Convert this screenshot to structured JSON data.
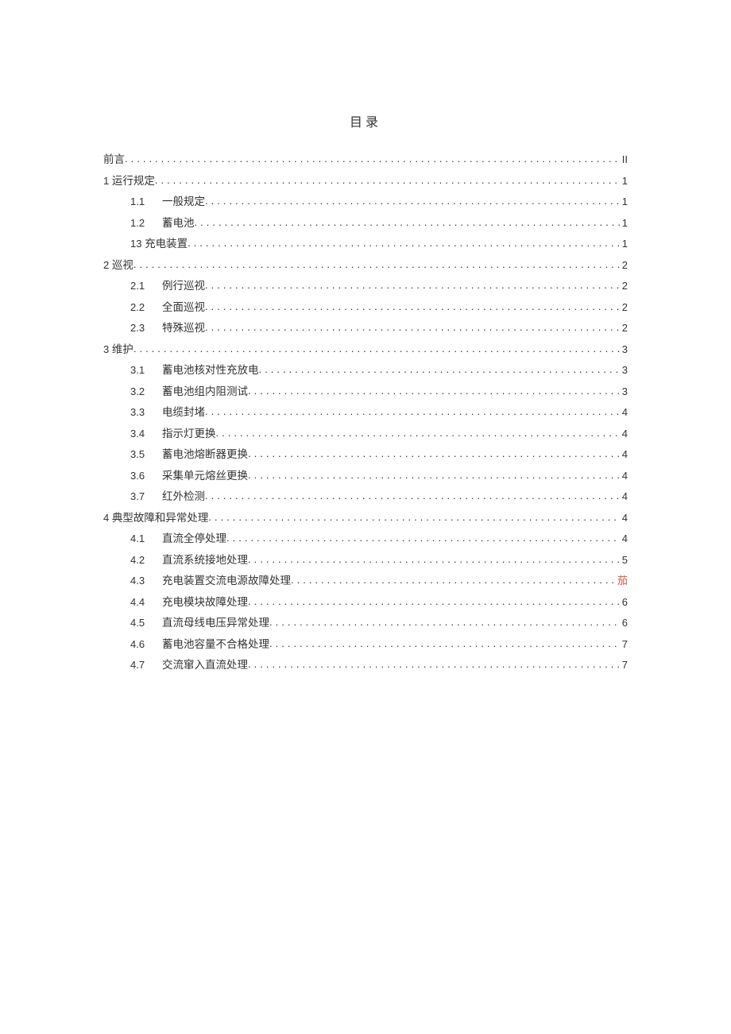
{
  "title": "目录",
  "entries": [
    {
      "level": 1,
      "num": "",
      "label": "前言",
      "page": "II",
      "roman": true
    },
    {
      "level": 1,
      "num": "1 ",
      "label": "运行规定",
      "page": "1"
    },
    {
      "level": 2,
      "num": "1.1",
      "label": "一般规定",
      "page": "1"
    },
    {
      "level": 2,
      "num": "1.2",
      "label": "蓄电池",
      "page": "1"
    },
    {
      "level": 2,
      "num": "13 ",
      "label": "充电装置",
      "page": "1",
      "tight": true
    },
    {
      "level": 1,
      "num": "2 ",
      "label": "巡视",
      "page": "2"
    },
    {
      "level": 2,
      "num": "2.1",
      "label": "例行巡视",
      "page": "2"
    },
    {
      "level": 2,
      "num": "2.2",
      "label": "全面巡视",
      "page": "2"
    },
    {
      "level": 2,
      "num": "2.3",
      "label": "特殊巡视",
      "page": "2"
    },
    {
      "level": 1,
      "num": "3 ",
      "label": "维护",
      "page": "3"
    },
    {
      "level": 2,
      "num": "3.1",
      "label": "蓄电池核对性充放电",
      "page": "3"
    },
    {
      "level": 2,
      "num": "3.2",
      "label": "蓄电池组内阻测试",
      "page": "3"
    },
    {
      "level": 2,
      "num": "3.3",
      "label": "电缆封堵",
      "page": "4"
    },
    {
      "level": 2,
      "num": "3.4",
      "label": "指示灯更换",
      "page": "4"
    },
    {
      "level": 2,
      "num": "3.5",
      "label": "蓄电池熔断器更换",
      "page": "4"
    },
    {
      "level": 2,
      "num": "3.6",
      "label": "采集单元熔丝更换",
      "page": "4"
    },
    {
      "level": 2,
      "num": "3.7",
      "label": "红外检测",
      "page": "4"
    },
    {
      "level": 1,
      "num": "4 ",
      "label": "典型故障和异常处理",
      "page": "4"
    },
    {
      "level": 2,
      "num": "4.1",
      "label": "直流全停处理",
      "page": "4"
    },
    {
      "level": 2,
      "num": "4.2",
      "label": "直流系统接地处理",
      "page": "5"
    },
    {
      "level": 2,
      "num": "4.3",
      "label": "充电装置交流电源故障处理",
      "page": "茄",
      "red": true
    },
    {
      "level": 2,
      "num": "4.4",
      "label": "充电模块故障处理",
      "page": "6"
    },
    {
      "level": 2,
      "num": "4.5",
      "label": "直流母线电压异常处理",
      "page": "6"
    },
    {
      "level": 2,
      "num": "4.6",
      "label": "蓄电池容量不合格处理",
      "page": "7"
    },
    {
      "level": 2,
      "num": "4.7",
      "label": "交流窜入直流处理",
      "page": "7"
    }
  ]
}
